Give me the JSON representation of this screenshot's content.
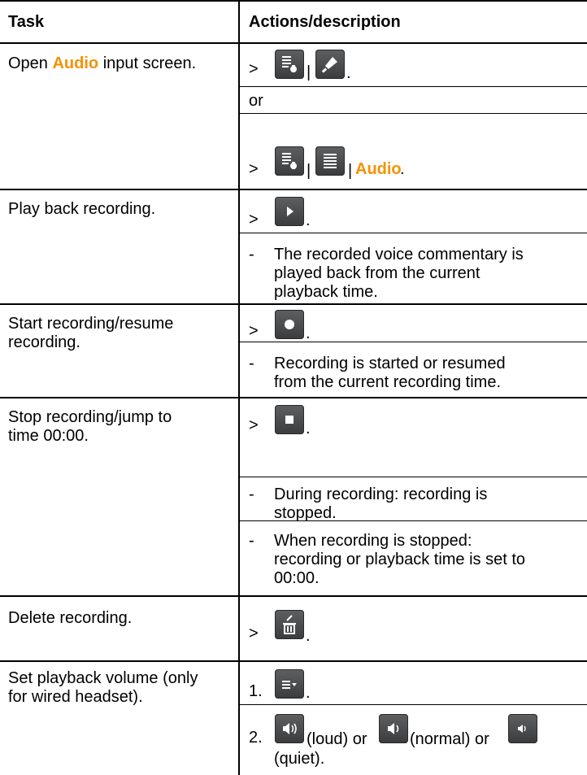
{
  "header": {
    "task": "Task",
    "actions": "Actions/description"
  },
  "rows": [
    {
      "task_a": "Open ",
      "task_hl": "Audio",
      "task_b": " input screen.",
      "gt": ">",
      "pipe": "|",
      "period": ".",
      "or": "or",
      "audio": "Audio",
      "icons": [
        "menu-touch-icon",
        "microphone-icon",
        "menu-touch-icon",
        "list-icon"
      ]
    },
    {
      "task_l1": "Play back recording.",
      "gt": ">",
      "period": ".",
      "icon": "play-icon",
      "dash": "-",
      "desc_l1": "The recorded voice commentary is",
      "desc_l2": "played back from the current",
      "desc_l3": "playback time."
    },
    {
      "task_l1": "Start recording/resume",
      "task_l2": "recording.",
      "gt": ">",
      "period": ".",
      "icon": "record-icon",
      "dash": "-",
      "desc_l1": "Recording is started or resumed",
      "desc_l2": "from the current recording time."
    },
    {
      "task_l1": "Stop recording/jump to",
      "task_l2": "time 00:00.",
      "gt": ">",
      "period": ".",
      "icon": "stop-icon",
      "dash": "-",
      "desc1_l1": "During recording: recording is",
      "desc1_l2": "stopped.",
      "desc2_l1": "When recording is stopped:",
      "desc2_l2": "recording or playback time is set to",
      "desc2_l3": "00:00."
    },
    {
      "task_l1": "Delete recording.",
      "gt": ">",
      "period": ".",
      "icon": "delete-icon"
    },
    {
      "task_l1": "Set playback volume (only",
      "task_l2": "for wired headset).",
      "step1": "1.",
      "step2": "2.",
      "period": ".",
      "loud": "(loud) or",
      "normal": "(normal) or",
      "quiet": "(quiet).",
      "icons": [
        "dropdown-menu-icon",
        "volume-loud-icon",
        "volume-normal-icon",
        "volume-quiet-icon"
      ]
    }
  ],
  "colors": {
    "accent": "#f39200",
    "icon_bg": "#4a4b4d"
  }
}
